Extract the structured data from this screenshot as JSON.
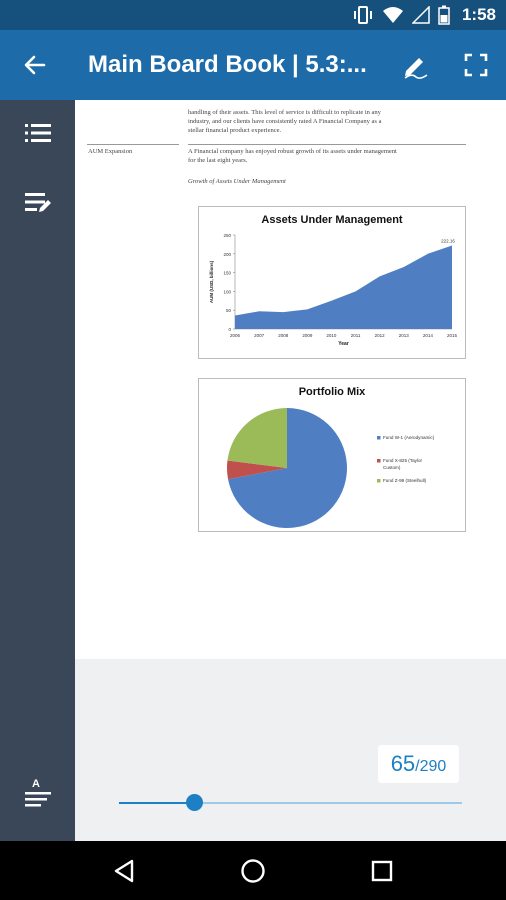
{
  "status": {
    "time": "1:58"
  },
  "app_bar": {
    "title": "Main Board Book | 5.3:..."
  },
  "document": {
    "intro_line1": "handling of their assets. This level of service is difficult to replicate in any",
    "intro_line2": "industry, and our clients have consistently rated A Financial Company as a",
    "intro_line3": "stellar financial product experience.",
    "section_label": "AUM Expansion",
    "section_line1": "A Financial company has enjoyed robust growth of its assets under management",
    "section_line2": "for the last eight years.",
    "figure_caption": "Growth of Assets Under Management"
  },
  "chart_data": [
    {
      "type": "area",
      "title": "Assets Under Management",
      "xlabel": "Year",
      "ylabel": "AUM (USD, billions)",
      "x": [
        "2006",
        "2007",
        "2008",
        "2009",
        "2010",
        "2011",
        "2012",
        "2013",
        "2014",
        "2015"
      ],
      "y": [
        36,
        47,
        45,
        52,
        75,
        100,
        140,
        165,
        200,
        222.16
      ],
      "ylim": [
        0,
        250
      ],
      "yticks": [
        0,
        50,
        100,
        150,
        200,
        250
      ],
      "annotation": "222.16",
      "colors": {
        "fill": "#4f7fc2"
      }
    },
    {
      "type": "pie",
      "title": "Portfolio Mix",
      "labels": [
        "Fund W-1 (Aerodynamic)",
        "Fund X-825 (Taylor Custom)",
        "Fund Z-99 (Steelhull)"
      ],
      "values": [
        72,
        5,
        23
      ],
      "colors": [
        "#4f7fc2",
        "#c0504d",
        "#9bbb59"
      ],
      "legend": "right"
    }
  ],
  "pager": {
    "current": "65",
    "total": "/290",
    "fraction": 0.22
  },
  "icons": {
    "back": "arrow-left-icon",
    "edit": "pen-icon",
    "fullscreen": "fullscreen-icon",
    "toc": "list-icon",
    "notes": "edit-list-icon",
    "text_size": "text-size-icon"
  }
}
